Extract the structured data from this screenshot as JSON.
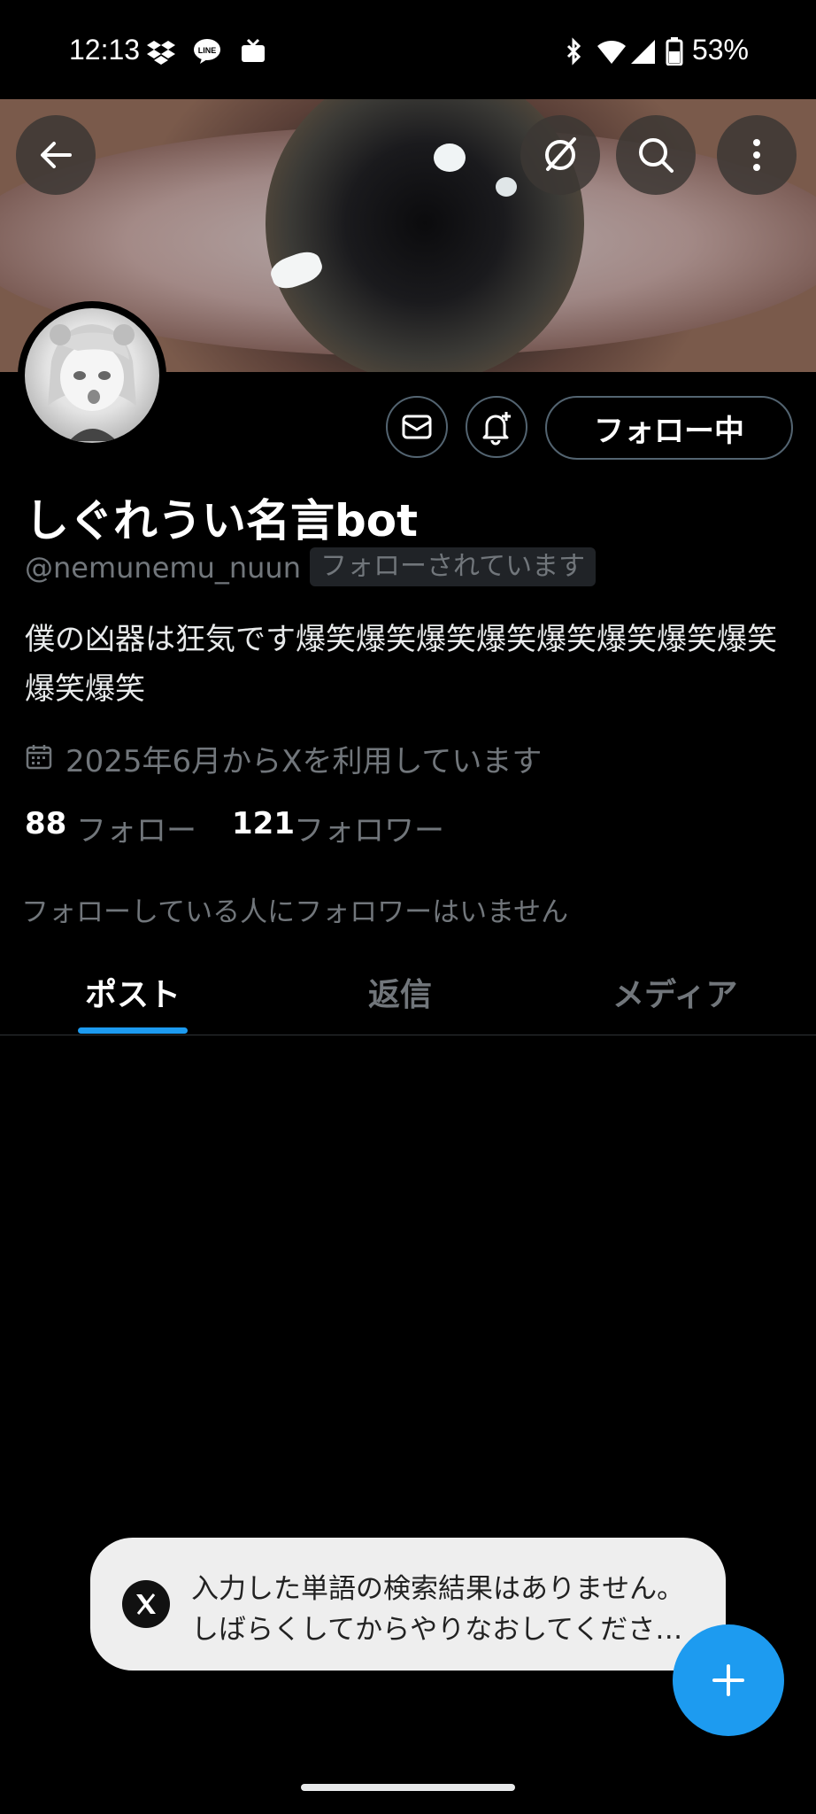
{
  "status_bar": {
    "time": "12:13",
    "battery": "53%",
    "icons": [
      "dropbox-icon",
      "line-icon",
      "tv-icon",
      "bluetooth-icon",
      "wifi-icon",
      "signal-icon",
      "battery-icon"
    ]
  },
  "header": {
    "back_icon": "back-arrow-icon",
    "grok_icon": "grok-icon",
    "search_icon": "search-icon",
    "more_icon": "more-vertical-icon"
  },
  "profile": {
    "display_name": "しぐれうい名言bot",
    "handle": "@nemunemu_nuun",
    "follows_you": "フォローされています",
    "bio": "僕の凶器は狂気です爆笑爆笑爆笑爆笑爆笑爆笑爆笑爆笑爆笑爆笑",
    "joined": "2025年6月からXを利用しています",
    "following_count": "88",
    "following_label": "フォロー",
    "followers_count": "121",
    "followers_label": "フォロワー",
    "known_followers": "フォローしている人にフォロワーはいません",
    "follow_button": "フォロー中"
  },
  "tabs": [
    {
      "label": "ポスト",
      "active": true
    },
    {
      "label": "返信",
      "active": false
    },
    {
      "label": "メディア",
      "active": false
    }
  ],
  "toast": {
    "line1": "入力した単語の検索結果はありません。",
    "line2": "しばらくしてからやりなおしてくださ…"
  },
  "colors": {
    "accent": "#1d9bf0",
    "background": "#000000",
    "muted_text": "#71767b"
  }
}
